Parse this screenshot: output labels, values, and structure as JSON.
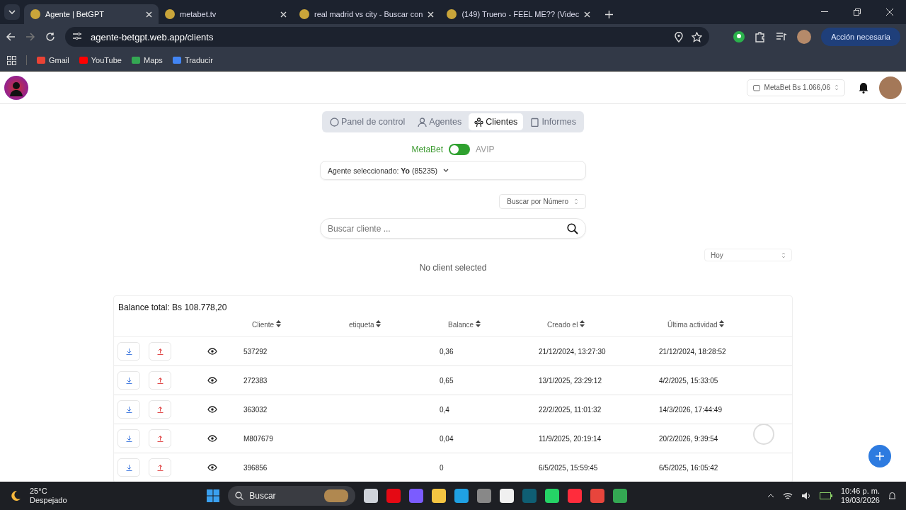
{
  "browser": {
    "tabs": [
      {
        "title": "Agente | BetGPT",
        "selected": true
      },
      {
        "title": "metabet.tv",
        "selected": false
      },
      {
        "title": "real madrid vs city - Buscar con",
        "selected": false
      },
      {
        "title": "(149) Trueno - FEEL ME?? (Videc",
        "selected": false
      }
    ],
    "address": "agente-betgpt.web.app/clients",
    "bookmarks": [
      {
        "label": "Gmail"
      },
      {
        "label": "YouTube"
      },
      {
        "label": "Maps"
      },
      {
        "label": "Traducir"
      }
    ],
    "action_button": "Acción necesaria"
  },
  "header": {
    "wallet": "MetaBet Bs 1.066,06"
  },
  "nav_tabs": [
    {
      "label": "Panel de control",
      "selected": false
    },
    {
      "label": "Agentes",
      "selected": false
    },
    {
      "label": "Clientes",
      "selected": true
    },
    {
      "label": "Informes",
      "selected": false
    }
  ],
  "platform_toggle": [
    {
      "label": "MetaBet",
      "selected": true
    },
    {
      "label": "AVIP",
      "selected": false
    }
  ],
  "agent_select": {
    "label": "Agente seleccionado:",
    "value": "Yo",
    "id": "(85235)"
  },
  "search_mode": "Buscar por Número",
  "search": {
    "placeholder": "Buscar cliente ..."
  },
  "period": "Hoy",
  "empty_message": "No client selected",
  "table": {
    "balance_total": "Balance total: Bs 108.778,20",
    "columns": [
      "Cliente",
      "etiqueta",
      "Balance",
      "Creado el",
      "Última actividad"
    ],
    "rows": [
      {
        "cliente": "537292",
        "balance": "0,36",
        "creado": "21/12/2024, 13:27:30",
        "actividad": "21/12/2024, 18:28:52"
      },
      {
        "cliente": "272383",
        "balance": "0,65",
        "creado": "13/1/2025, 23:29:12",
        "actividad": "4/2/2025, 15:33:05"
      },
      {
        "cliente": "363032",
        "balance": "0,4",
        "creado": "22/2/2025, 11:01:32",
        "actividad": "14/3/2026, 17:44:49"
      },
      {
        "cliente": "M807679",
        "balance": "0,04",
        "creado": "11/9/2025, 20:19:14",
        "actividad": "20/2/2026, 9:39:54"
      },
      {
        "cliente": "396856",
        "balance": "0",
        "creado": "6/5/2025, 15:59:45",
        "actividad": "6/5/2025, 16:05:42"
      }
    ]
  },
  "taskbar": {
    "temperature": "25°C",
    "weather": "Despejado",
    "search_placeholder": "Buscar",
    "time": "10:46 p. m.",
    "date": "19/03/2026"
  }
}
